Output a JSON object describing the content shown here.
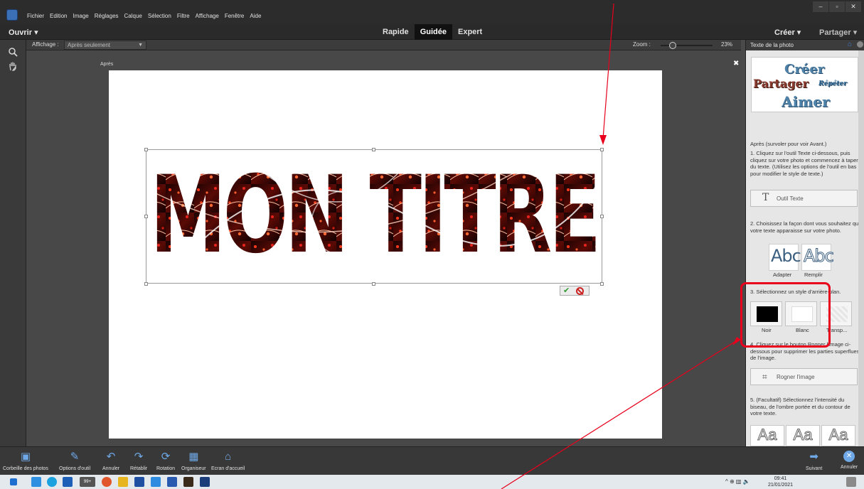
{
  "menu": [
    "Fichier",
    "Edition",
    "Image",
    "Réglages",
    "Calque",
    "Sélection",
    "Filtre",
    "Affichage",
    "Fenêtre",
    "Aide"
  ],
  "window_controls": [
    "–",
    "▫",
    "✕"
  ],
  "modebar": {
    "open_label": "Ouvrir  ▾",
    "modes": [
      "Rapide",
      "Guidée",
      "Expert"
    ],
    "active_mode": "Guidée",
    "create_label": "Créer  ▾",
    "share_label": "Partager ▾"
  },
  "options": {
    "view_label": "Affichage :",
    "view_value": "Après seulement",
    "zoom_label": "Zoom :",
    "zoom_value": "23%",
    "zoom_level_percent": 23
  },
  "canvas": {
    "doc_label": "Après",
    "close_icon": "✖",
    "title_text": "MON TITRE",
    "commit_ok": "✔"
  },
  "panel": {
    "title": "Texte de la photo",
    "preview_words": [
      "Créer",
      "Partager",
      "Répéter",
      "Aimer"
    ],
    "caption": "Après (survoler pour voir Avant.)",
    "step1": "1. Cliquez sur l'outil Texte ci-dessous, puis cliquez sur votre photo et commencez à taper du texte. (Utilisez les options de l'outil en bas pour modifier le style de texte.)",
    "text_tool_icon": "T",
    "text_tool_label": "Outil Texte",
    "step2": "2. Choisissez la façon dont vous souhaitez que votre texte apparaisse sur votre photo.",
    "style_sample": "Abc",
    "style_fit_label": "Adapter",
    "style_fill_label": "Remplir",
    "step3": "3. Sélectionnez un style d'arrière-plan.",
    "bg_black": "Noir",
    "bg_white": "Blanc",
    "bg_transp": "Transp...",
    "step4": "4. Cliquez sur le bouton Rogner l'image ci-dessous pour supprimer les parties superflues de l'image.",
    "crop_icon": "⌗",
    "crop_label": "Rogner l'image",
    "step5": "5. (Facultatif) Sélectionnez l'intensité du biseau, de l'ombre portée et du contour de votre texte.",
    "bevel_sample": "Aa"
  },
  "bottom": {
    "items": [
      {
        "icon": "▣",
        "label": "Corbeille des photos"
      },
      {
        "icon": "✎",
        "label": "Options d'outil"
      },
      {
        "icon": "↶",
        "label": "Annuler"
      },
      {
        "icon": "↷",
        "label": "Rétablir"
      },
      {
        "icon": "⟳",
        "label": "Rotation"
      },
      {
        "icon": "▦",
        "label": "Organiseur"
      },
      {
        "icon": "⌂",
        "label": "Ecran d'accueil"
      }
    ],
    "next_icon": "➡",
    "next_label": "Suivant",
    "cancel_icon": "✕",
    "cancel_label": "Annuler"
  },
  "taskbar": {
    "time": "09:41",
    "date": "21/01/2021",
    "tray_icons": "^  ⊕  ▥  🔈",
    "notif_badge": "99+"
  },
  "colors": {
    "accent_red": "#e8001c",
    "panel_bg": "#e6e6e6",
    "blue_icon": "#6fa8e6"
  }
}
